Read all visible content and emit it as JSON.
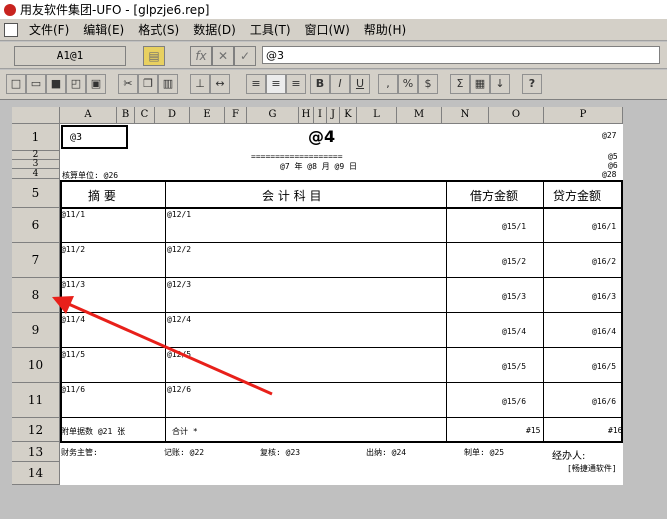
{
  "window": {
    "title": "用友软件集团-UFO - [glpzje6.rep]"
  },
  "menu": [
    "文件(F)",
    "编辑(E)",
    "格式(S)",
    "数据(D)",
    "工具(T)",
    "窗口(W)",
    "帮助(H)"
  ],
  "formula_bar": {
    "cell_ref": "A1@1",
    "value": "@3",
    "fx": "fx",
    "cancel": "✕",
    "ok": "✓"
  },
  "toolbar": {
    "bold": "B",
    "italic": "I",
    "underline": "U",
    "comma": ",",
    "percent": "%",
    "currency": "$",
    "help": "?"
  },
  "columns": [
    "A",
    "B",
    "C",
    "D",
    "E",
    "F",
    "G",
    "H",
    "I",
    "J",
    "K",
    "L",
    "M",
    "N",
    "O",
    "P"
  ],
  "rows": [
    "1",
    "2",
    "3",
    "4",
    "5",
    "6",
    "7",
    "8",
    "9",
    "10",
    "11",
    "12",
    "13",
    "14"
  ],
  "report": {
    "a1": "@3",
    "title": "@4",
    "p1": "@27",
    "p2": "@5",
    "p3": "@6",
    "p4": "@28",
    "underline": "===================",
    "date": "@7 年 @8 月 @9 日",
    "unit": "核算单位: @26",
    "h_summary": "摘    要",
    "h_account": "会 计 科 目",
    "h_debit": "借方金额",
    "h_credit": "贷方金额",
    "lines": [
      {
        "s": "@11/1",
        "a": "@12/1",
        "d": "@15/1",
        "c": "@16/1"
      },
      {
        "s": "@11/2",
        "a": "@12/2",
        "d": "@15/2",
        "c": "@16/2"
      },
      {
        "s": "@11/3",
        "a": "@12/3",
        "d": "@15/3",
        "c": "@16/3"
      },
      {
        "s": "@11/4",
        "a": "@12/4",
        "d": "@15/4",
        "c": "@16/4"
      },
      {
        "s": "@11/5",
        "a": "@12/5",
        "d": "@15/5",
        "c": "@16/5"
      },
      {
        "s": "@11/6",
        "a": "@12/6",
        "d": "@15/6",
        "c": "@16/6"
      }
    ],
    "attach": "附单据数  @21 张",
    "total": "合计 *",
    "total_d": "#15",
    "total_c": "#16",
    "f1": "财务主管:",
    "f2": "记账: @22",
    "f3": "复核: @23",
    "f4": "出纳: @24",
    "f5": "制单: @25",
    "f6": "经办人:",
    "brand": "[畅捷通软件]"
  }
}
